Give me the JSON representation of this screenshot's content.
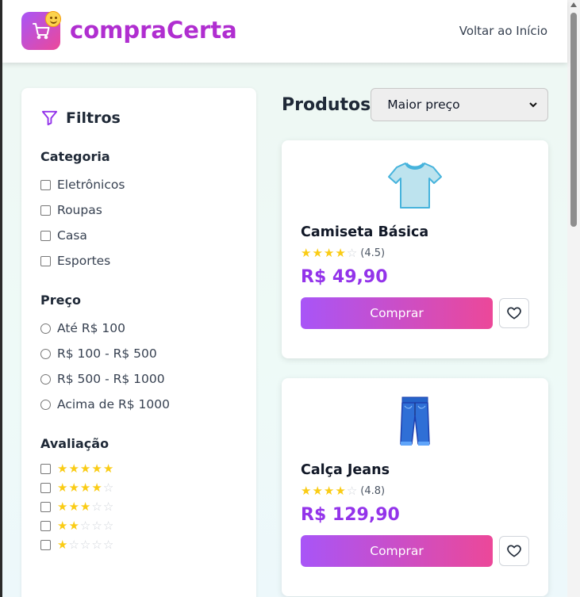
{
  "header": {
    "brand": "compraCerta",
    "back_link": "Voltar ao Início"
  },
  "filters": {
    "title": "Filtros",
    "category": {
      "title": "Categoria",
      "options": [
        "Eletrônicos",
        "Roupas",
        "Casa",
        "Esportes"
      ]
    },
    "price": {
      "title": "Preço",
      "options": [
        "Até R$ 100",
        "R$ 100 - R$ 500",
        "R$ 500 - R$ 1000",
        "Acima de R$ 1000"
      ]
    },
    "rating": {
      "title": "Avaliação",
      "options": [
        5,
        4,
        3,
        2,
        1
      ]
    }
  },
  "products": {
    "title": "Produtos",
    "sort_selected": "Maior preço",
    "items": [
      {
        "name": "Camiseta Básica",
        "rating": 4.5,
        "rating_label": "(4.5)",
        "price": "R$ 49,90",
        "buy_label": "Comprar",
        "icon": "tshirt-icon"
      },
      {
        "name": "Calça Jeans",
        "rating": 4.8,
        "rating_label": "(4.8)",
        "price": "R$ 129,90",
        "buy_label": "Comprar",
        "icon": "jeans-icon"
      }
    ]
  },
  "colors": {
    "brand": "#b02ed0",
    "price": "#9333ea",
    "gradient_start": "#a855f7",
    "gradient_end": "#ec4899",
    "star": "#facc15"
  }
}
